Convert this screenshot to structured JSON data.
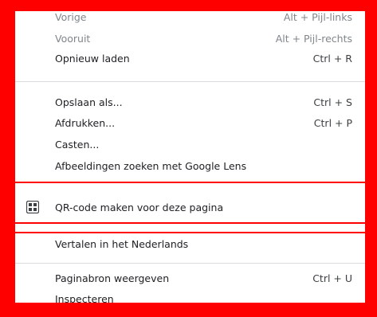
{
  "menu": {
    "items": [
      {
        "label": "Vorige",
        "shortcut": "Alt + Pijl-links"
      },
      {
        "label": "Vooruit",
        "shortcut": "Alt + Pijl-rechts"
      },
      {
        "label": "Opnieuw laden",
        "shortcut": "Ctrl + R"
      },
      {
        "label": "Opslaan als...",
        "shortcut": "Ctrl + S"
      },
      {
        "label": "Afdrukken...",
        "shortcut": "Ctrl + P"
      },
      {
        "label": "Casten..."
      },
      {
        "label": "Afbeeldingen zoeken met Google Lens"
      },
      {
        "label": "QR-code maken voor deze pagina",
        "icon": "qr-code-icon"
      },
      {
        "label": "Vertalen in het Nederlands"
      },
      {
        "label": "Paginabron weergeven",
        "shortcut": "Ctrl + U"
      },
      {
        "label": "Inspecteren"
      }
    ]
  },
  "colors": {
    "highlight_border": "#ff0000",
    "separator": "#dadce0",
    "disabled_text": "#80868b"
  }
}
